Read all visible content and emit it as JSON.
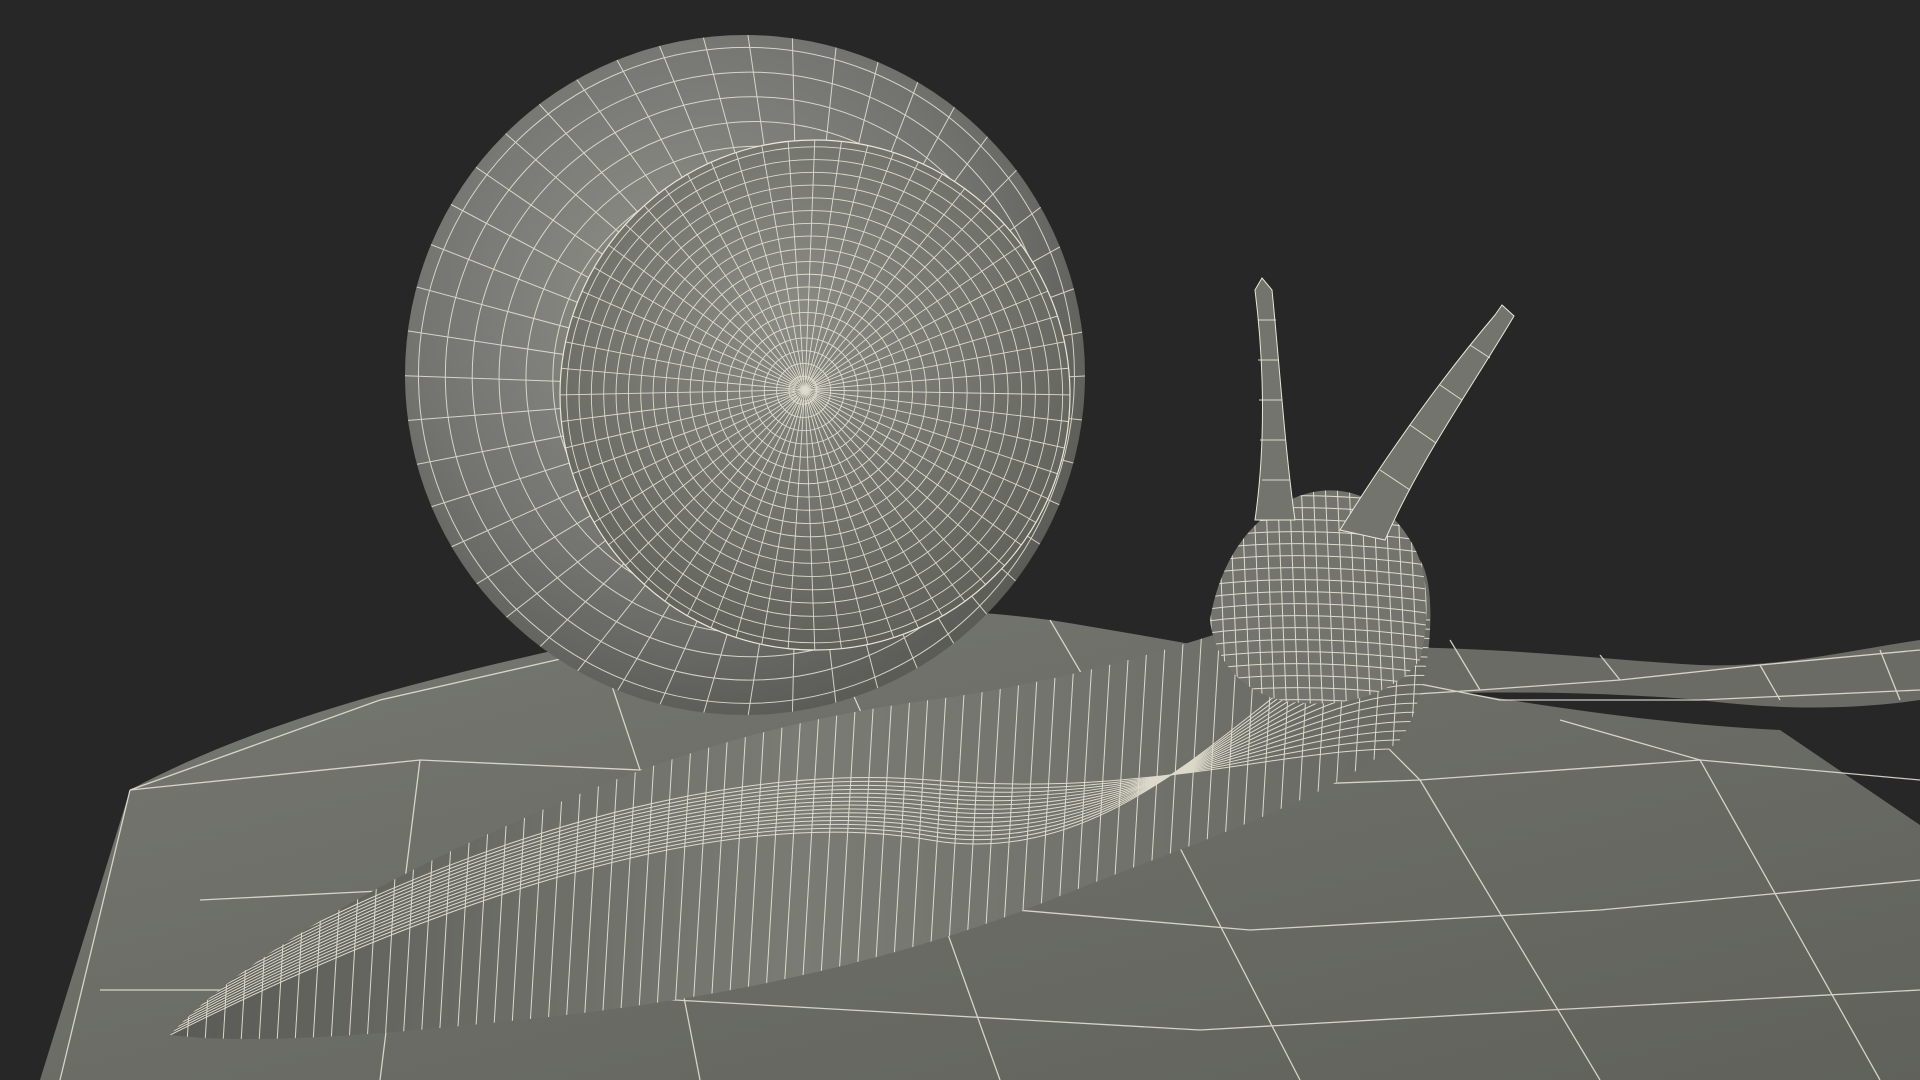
{
  "scene": {
    "subject": "snail-wireframe-render",
    "colors": {
      "background": "#272727",
      "surface": "#6f706a",
      "surface_light": "#8a8b84",
      "surface_dark": "#4f504b",
      "wire": "#e9e6d6"
    }
  }
}
